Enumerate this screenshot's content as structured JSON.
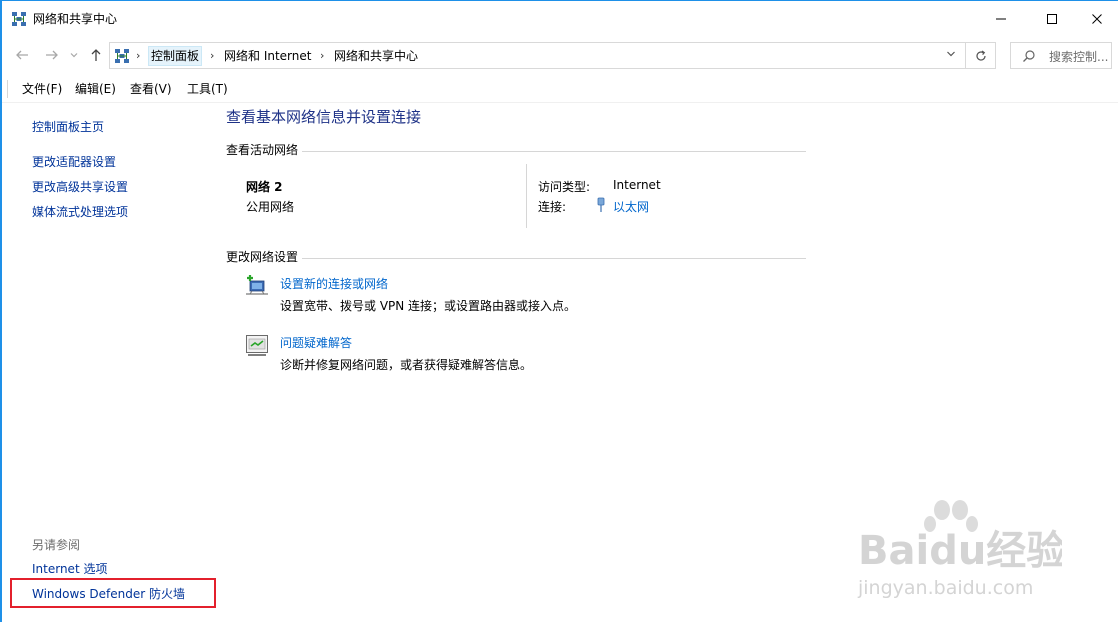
{
  "window": {
    "title": "网络和共享中心"
  },
  "address": {
    "crumbs": [
      "控制面板",
      "网络和 Internet",
      "网络和共享中心"
    ],
    "search_placeholder": "搜索控制..."
  },
  "menu": {
    "items": [
      "文件(F)",
      "编辑(E)",
      "查看(V)",
      "工具(T)"
    ]
  },
  "left_pane": {
    "links": [
      "控制面板主页",
      "更改适配器设置",
      "更改高级共享设置",
      "媒体流式处理选项"
    ],
    "see_also_heading": "另请参阅",
    "see_also_links": [
      "Internet 选项",
      "Windows Defender 防火墙"
    ]
  },
  "main": {
    "title": "查看基本网络信息并设置连接",
    "active_networks_heading": "查看活动网络",
    "network": {
      "name": "网络 2",
      "type": "公用网络",
      "access_type_label": "访问类型:",
      "access_type_value": "Internet",
      "connection_label": "连接:",
      "connection_value": "以太网"
    },
    "change_settings_heading": "更改网络设置",
    "tasks": [
      {
        "title": "设置新的连接或网络",
        "description": "设置宽带、拨号或 VPN 连接；或设置路由器或接入点。",
        "icon": "new-connection-icon"
      },
      {
        "title": "问题疑难解答",
        "description": "诊断并修复网络问题，或者获得疑难解答信息。",
        "icon": "troubleshoot-icon"
      }
    ]
  },
  "watermark": {
    "brand": "Baidu经验",
    "url": "jingyan.baidu.com"
  },
  "colors": {
    "link": "#0066cc",
    "nav_link": "#003399",
    "title": "#1e3287",
    "highlight": "#e3202c",
    "frame": "#1e90e8"
  }
}
